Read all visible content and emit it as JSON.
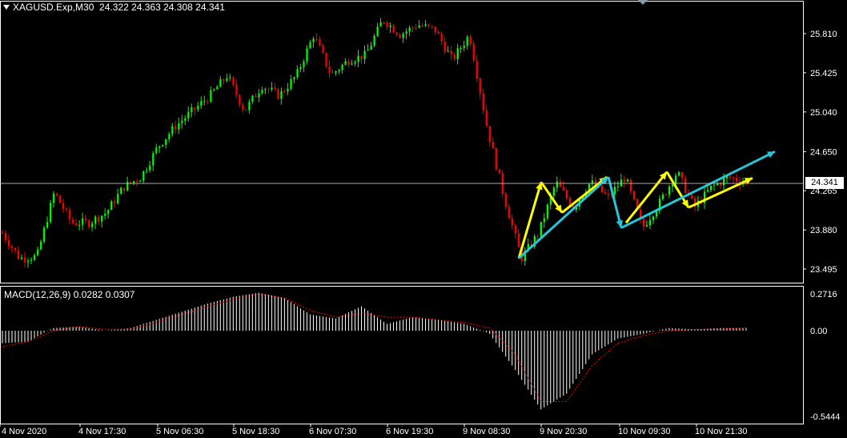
{
  "header": {
    "symbol": "XAGUSD.Exp,M30",
    "ohlc": "24.322 24.363 24.308 24.341"
  },
  "macd_header": {
    "label": "MACD(12,26,9)",
    "values": "0.0282 0.0307"
  },
  "current_price": "24.341",
  "colors": {
    "background": "#000000",
    "bull": "#00ff00",
    "bear": "#ff0000",
    "price_line": "#c0c0c0",
    "yellow_arrows": "#ffff00",
    "cyan_arrows": "#26c6da",
    "macd_hist": "#ffffff",
    "macd_signal": "#ff0000"
  },
  "chart_data": [
    {
      "type": "candlestick",
      "title": "XAGUSD.Exp,M30",
      "ylim": [
        23.3,
        26.1
      ],
      "y_ticks": [
        "25.810",
        "25.425",
        "25.040",
        "24.650",
        "24.265",
        "23.880",
        "23.495"
      ],
      "x_ticks": [
        "4 Nov 2020",
        "4 Nov 17:30",
        "5 Nov 06:30",
        "5 Nov 18:30",
        "6 Nov 07:30",
        "6 Nov 19:30",
        "9 Nov 08:30",
        "9 Nov 20:30",
        "10 Nov 09:30",
        "10 Nov 21:30"
      ],
      "close_path": [
        23.85,
        23.6,
        23.62,
        24.25,
        23.95,
        23.95,
        24.05,
        24.3,
        24.4,
        24.7,
        24.9,
        25.05,
        25.2,
        25.4,
        25.05,
        25.3,
        25.2,
        25.4,
        25.8,
        25.4,
        25.55,
        25.6,
        25.95,
        25.8,
        25.9,
        25.85,
        25.55,
        25.8,
        24.9,
        24.2,
        23.6,
        23.85,
        24.35,
        24.1,
        24.35,
        24.2,
        24.4,
        23.9,
        24.15,
        24.45,
        24.1,
        24.3,
        24.4,
        24.341
      ],
      "annotations": {
        "yellow": [
          [
            23.6,
            24.35
          ],
          [
            24.35,
            24.05
          ],
          [
            24.05,
            24.4
          ],
          [
            23.95,
            24.45
          ],
          [
            24.45,
            24.1
          ],
          [
            24.1,
            24.39
          ]
        ],
        "cyan": [
          [
            23.6,
            24.4
          ],
          [
            24.4,
            23.9
          ],
          [
            23.9,
            24.65
          ]
        ]
      }
    },
    {
      "type": "bar",
      "title": "MACD(12,26,9)",
      "ylim": [
        -0.58,
        0.31
      ],
      "y_ticks": [
        "0.2716",
        "0.00",
        "-0.5444"
      ],
      "series": [
        {
          "name": "main",
          "values": [
            -0.08,
            -0.07,
            0.02,
            0.03,
            0.0,
            0.02,
            0.08,
            0.14,
            0.2,
            0.25,
            0.28,
            0.24,
            0.12,
            0.09,
            0.18,
            0.05,
            0.1,
            0.08,
            0.05,
            -0.02,
            -0.25,
            -0.5,
            -0.4,
            -0.15,
            -0.05,
            -0.02,
            0.02,
            0.01,
            0.02,
            0.02
          ]
        },
        {
          "name": "signal",
          "values": [
            -0.1,
            -0.07,
            0.0,
            0.03,
            0.01,
            0.01,
            0.06,
            0.12,
            0.18,
            0.23,
            0.27,
            0.24,
            0.15,
            0.1,
            0.13,
            0.1,
            0.1,
            0.08,
            0.06,
            0.02,
            -0.15,
            -0.45,
            -0.45,
            -0.22,
            -0.08,
            -0.03,
            0.0,
            0.01,
            0.01,
            0.02
          ]
        }
      ]
    }
  ]
}
